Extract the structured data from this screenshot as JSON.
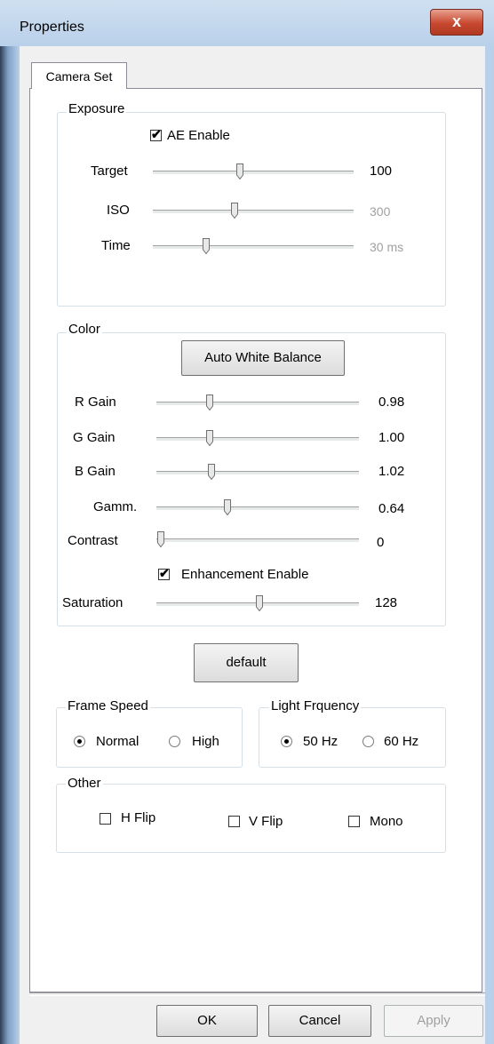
{
  "window": {
    "title": "Properties",
    "close_glyph": "x"
  },
  "tabs": [
    {
      "label": "Camera Set",
      "active": true
    }
  ],
  "exposure": {
    "label": "Exposure",
    "ae_enable": {
      "label": "AE Enable",
      "checked": true
    },
    "sliders": [
      {
        "label": "Target",
        "value": "100",
        "enabled": true,
        "position_fraction": 0.44
      },
      {
        "label": "ISO",
        "value": "300",
        "enabled": false,
        "position_fraction": 0.41
      },
      {
        "label": "Time",
        "value": "30 ms",
        "enabled": false,
        "position_fraction": 0.26
      }
    ]
  },
  "color": {
    "label": "Color",
    "awb_button": "Auto White Balance",
    "sliders": [
      {
        "label": "R Gain",
        "value": "0.98",
        "position_fraction": 0.26
      },
      {
        "label": "G Gain",
        "value": "1.00",
        "position_fraction": 0.26
      },
      {
        "label": "B Gain",
        "value": "1.02",
        "position_fraction": 0.27
      },
      {
        "label": "Gamm.",
        "value": "0.64",
        "position_fraction": 0.35
      }
    ],
    "contrast": {
      "label": "Contrast",
      "value": "0",
      "position_fraction": 0.0
    },
    "enhancement": {
      "label": "Enhancement Enable",
      "checked": true
    },
    "saturation": {
      "label": "Saturation",
      "value": "128",
      "position_fraction": 0.5
    }
  },
  "default_button": "default",
  "frame_speed": {
    "label": "Frame Speed",
    "options": [
      "Normal",
      "High"
    ],
    "selected": "Normal"
  },
  "light_frequency": {
    "label": "Light Frquency",
    "options": [
      "50 Hz",
      "60 Hz"
    ],
    "selected": "50 Hz"
  },
  "other": {
    "label": "Other",
    "checkboxes": [
      {
        "label": "H Flip",
        "checked": false
      },
      {
        "label": "V Flip",
        "checked": false
      },
      {
        "label": "Mono",
        "checked": false
      }
    ]
  },
  "buttons": {
    "ok": "OK",
    "cancel": "Cancel",
    "apply": "Apply"
  }
}
